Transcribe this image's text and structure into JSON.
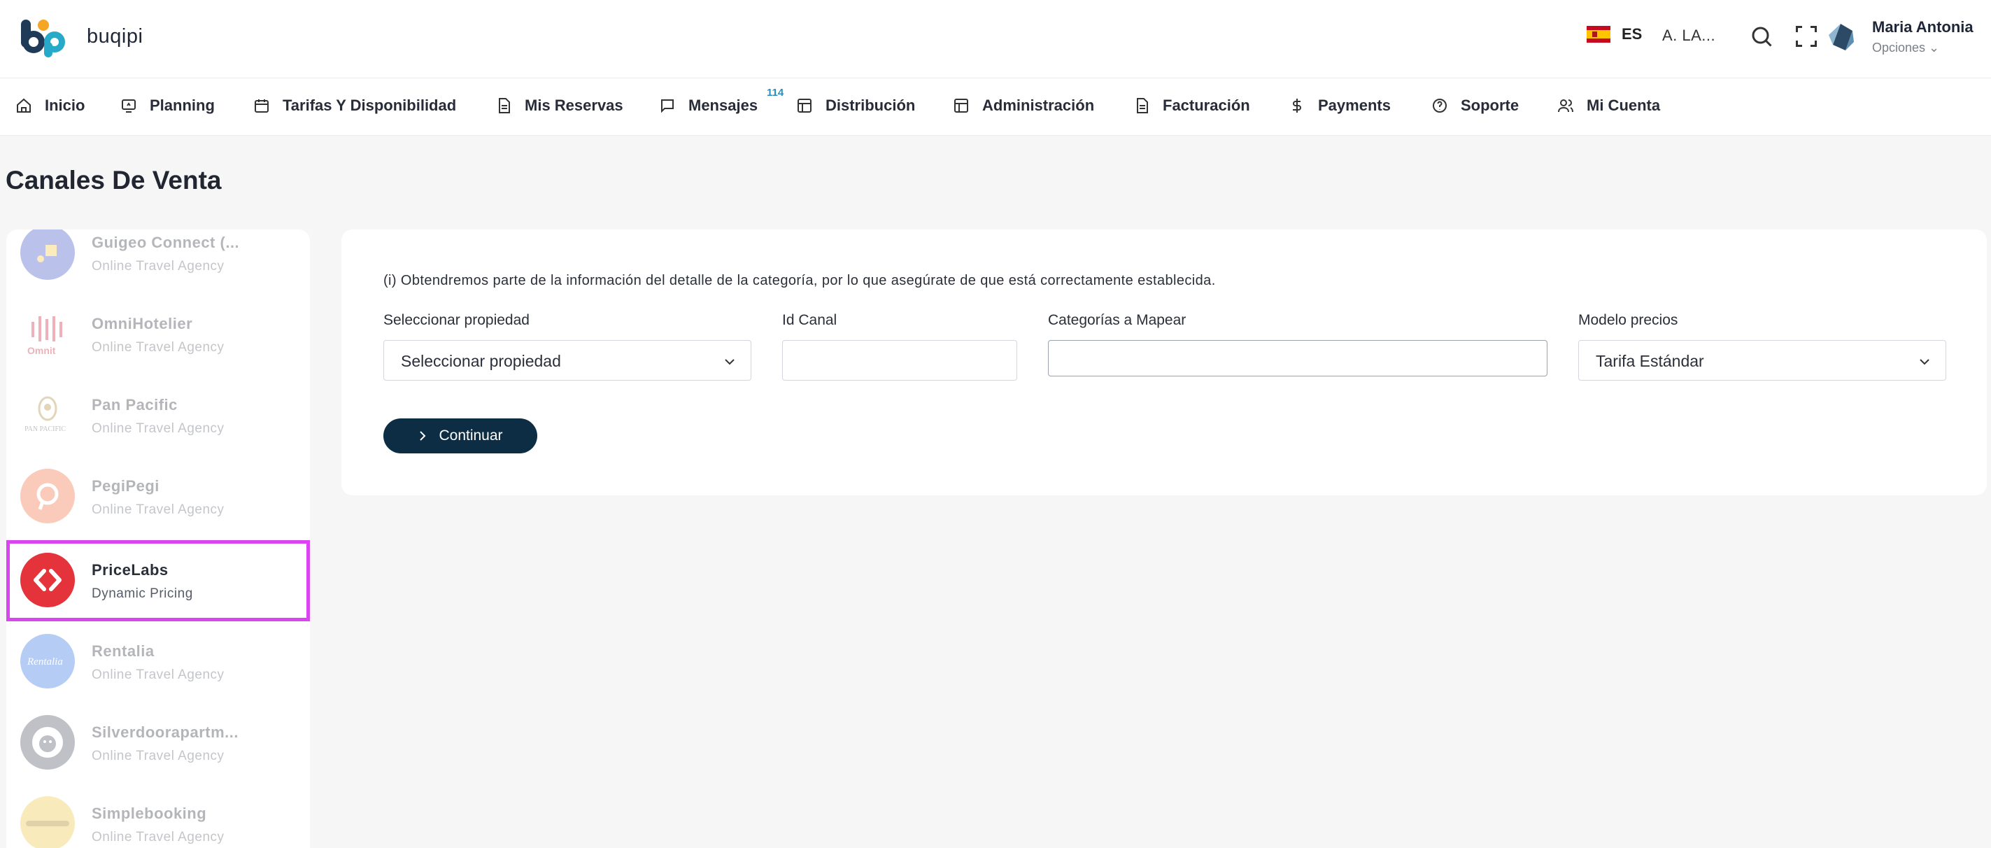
{
  "header": {
    "brand": "buqipi",
    "language": "ES",
    "property_short": "A. LA...",
    "user_name": "Maria Antonia",
    "user_options": "Opciones ⌄"
  },
  "nav": {
    "items": [
      {
        "label": "Inicio",
        "icon": "home-icon"
      },
      {
        "label": "Planning",
        "icon": "planning-icon"
      },
      {
        "label": "Tarifas Y Disponibilidad",
        "icon": "calendar-icon"
      },
      {
        "label": "Mis Reservas",
        "icon": "document-icon"
      },
      {
        "label": "Mensajes",
        "icon": "chat-icon"
      },
      {
        "label": "Distribución",
        "icon": "layout-icon"
      },
      {
        "label": "Administración",
        "icon": "layout-icon"
      },
      {
        "label": "Facturación",
        "icon": "document-icon"
      },
      {
        "label": "Payments",
        "icon": "dollar-icon"
      },
      {
        "label": "Soporte",
        "icon": "help-icon"
      },
      {
        "label": "Mi Cuenta",
        "icon": "users-icon"
      }
    ],
    "messages_badge": "114"
  },
  "page": {
    "title": "Canales De Venta"
  },
  "channels": [
    {
      "name": "Guigeo Connect (...",
      "type": "Online Travel Agency",
      "color": "#3b4fc4"
    },
    {
      "name": "OmniHotelier",
      "type": "Online Travel Agency",
      "color": "#d1213a"
    },
    {
      "name": "Pan Pacific",
      "type": "Online Travel Agency",
      "color": "#b08a3a"
    },
    {
      "name": "PegiPegi",
      "type": "Online Travel Agency",
      "color": "#f26a3b"
    },
    {
      "name": "PriceLabs",
      "type": "Dynamic Pricing",
      "color": "#e5333b"
    },
    {
      "name": "Rentalia",
      "type": "Online Travel Agency",
      "color": "#2f6fe0"
    },
    {
      "name": "Silverdoorapartm...",
      "type": "Online Travel Agency",
      "color": "#4a4f62"
    },
    {
      "name": "Simplebooking",
      "type": "Online Travel Agency",
      "color": "#f0c640"
    }
  ],
  "form": {
    "info": "(i) Obtendremos parte de la información del detalle de la categoría, por lo que asegúrate de que está correctamente establecida.",
    "property_label": "Seleccionar propiedad",
    "property_value": "Seleccionar propiedad",
    "channel_id_label": "Id Canal",
    "channel_id_value": "",
    "categories_label": "Categorías a Mapear",
    "categories_value": "",
    "pricing_label": "Modelo precios",
    "pricing_value": "Tarifa Estándar",
    "continue_label": "Continuar"
  },
  "colors": {
    "primary_button": "#0c2d44",
    "selected_outline": "#d946ef",
    "badge": "#2a8fbd"
  }
}
